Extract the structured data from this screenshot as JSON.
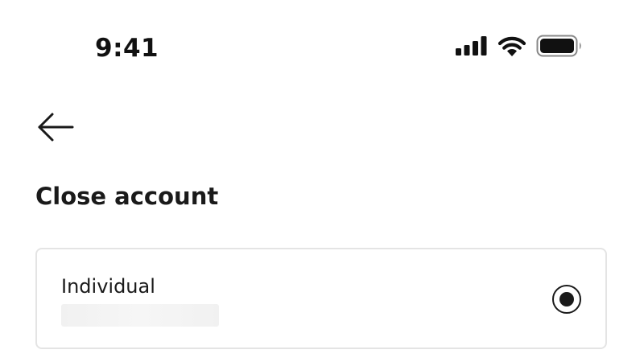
{
  "status_bar": {
    "time": "9:41",
    "icons": [
      "cellular-signal-icon",
      "wifi-icon",
      "battery-icon"
    ]
  },
  "header": {
    "back_icon": "back-arrow-icon"
  },
  "page": {
    "title": "Close account"
  },
  "account_option": {
    "type_label": "Individual",
    "selected": true,
    "selected_icon": "radio-selected-icon"
  },
  "colors": {
    "text": "#1a1a1a",
    "card_border": "#e4e4e4",
    "background": "#ffffff"
  }
}
